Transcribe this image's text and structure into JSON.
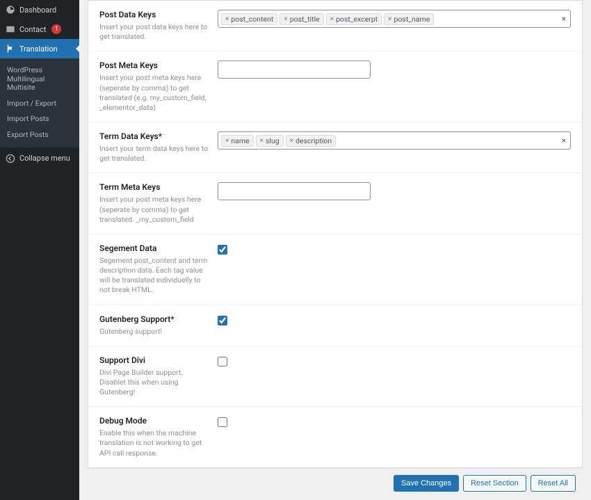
{
  "sidebar": {
    "dashboard": "Dashboard",
    "contact": "Contact",
    "contact_badge": "1",
    "translation": "Translation",
    "submenu": {
      "wp_multisite": "WordPress Multilingual Multisite",
      "import_export": "Import / Export",
      "import_posts": "Import Posts",
      "export_posts": "Export Posts"
    },
    "collapse": "Collapse menu"
  },
  "fields": {
    "post_data_keys": {
      "label": "Post Data Keys",
      "desc": "Insert your post data keys here to get translated.",
      "tags": [
        "post_content",
        "post_title",
        "post_excerpt",
        "post_name"
      ]
    },
    "post_meta_keys": {
      "label": "Post Meta Keys",
      "desc": "Insert your post meta keys here (seperate by comma) to get translated (e.g. my_custom_field, _elementor_data)"
    },
    "term_data_keys": {
      "label": "Term Data Keys*",
      "desc": "Insert your term data keys here to get translated.",
      "tags": [
        "name",
        "slug",
        "description"
      ]
    },
    "term_meta_keys": {
      "label": "Term Meta Keys",
      "desc": "Insert your post meta keys here (seperate by comma) to get translated. _my_custom_field"
    },
    "segment_data": {
      "label": "Segement Data",
      "desc": "Segement post_content and term description data. Each tag value will be translated individuelly to not break HTML."
    },
    "gutenberg": {
      "label": "Gutenberg Support*",
      "desc": "Gutenberg support!"
    },
    "divi": {
      "label": "Support Divi",
      "desc": "Divi Page Builder support. Disablet this when using Gutenberg!"
    },
    "debug": {
      "label": "Debug Mode",
      "desc": "Enable this when the machine translation is not working to get API call response."
    }
  },
  "buttons": {
    "save": "Save Changes",
    "reset_section": "Reset Section",
    "reset_all": "Reset All"
  },
  "footer": ""
}
